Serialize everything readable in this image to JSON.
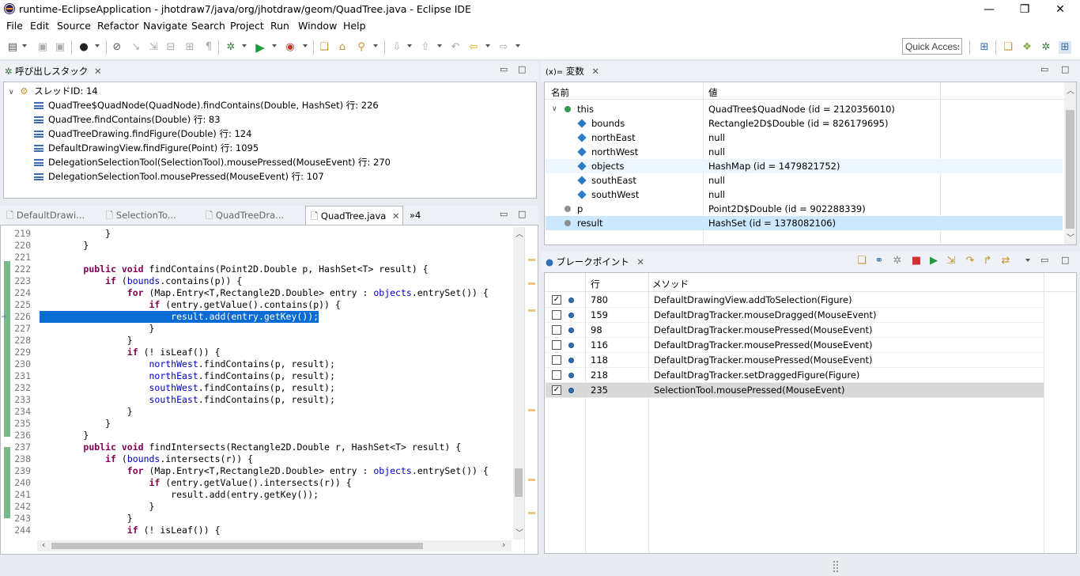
{
  "window": {
    "title": "runtime-EclipseApplication - jhotdraw7/java/org/jhotdraw/geom/QuadTree.java - Eclipse IDE",
    "minimize": "—",
    "restore": "❐",
    "close": "✕"
  },
  "menu": [
    "File",
    "Edit",
    "Source",
    "Refactor",
    "Navigate",
    "Search",
    "Project",
    "Run",
    "Window",
    "Help"
  ],
  "quick_access": "Quick Access",
  "callstack": {
    "tab_label": "呼び出しスタック",
    "thread": "スレッドID: 14",
    "frames": [
      "QuadTree$QuadNode(QuadNode).findContains(Double, HashSet) 行: 226",
      "QuadTree.findContains(Double) 行: 83",
      "QuadTreeDrawing.findFigure(Double) 行: 124",
      "DefaultDrawingView.findFigure(Point) 行: 1095",
      "DelegationSelectionTool(SelectionTool).mousePressed(MouseEvent) 行: 270",
      "DelegationSelectionTool.mousePressed(MouseEvent) 行: 107"
    ]
  },
  "editor": {
    "tabs": [
      "DefaultDrawi...",
      "SelectionTo...",
      "QuadTreeDra...",
      "QuadTree.java"
    ],
    "active_tab": 3,
    "overflow": "»4",
    "highlight_line": 226,
    "lines": [
      {
        "n": "219",
        "t": "            }"
      },
      {
        "n": "220",
        "t": "        }"
      },
      {
        "n": "221",
        "t": ""
      },
      {
        "n": "222",
        "t": "        public void findContains(Point2D.Double p, HashSet<T> result) {"
      },
      {
        "n": "223",
        "t": "            if (bounds.contains(p)) {"
      },
      {
        "n": "224",
        "t": "                for (Map.Entry<T,Rectangle2D.Double> entry : objects.entrySet()) {"
      },
      {
        "n": "225",
        "t": "                    if (entry.getValue().contains(p)) {"
      },
      {
        "n": "226",
        "t": "                        result.add(entry.getKey());"
      },
      {
        "n": "227",
        "t": "                    }"
      },
      {
        "n": "228",
        "t": "                }"
      },
      {
        "n": "229",
        "t": "                if (! isLeaf()) {"
      },
      {
        "n": "230",
        "t": "                    northWest.findContains(p, result);"
      },
      {
        "n": "231",
        "t": "                    northEast.findContains(p, result);"
      },
      {
        "n": "232",
        "t": "                    southWest.findContains(p, result);"
      },
      {
        "n": "233",
        "t": "                    southEast.findContains(p, result);"
      },
      {
        "n": "234",
        "t": "                }"
      },
      {
        "n": "235",
        "t": "            }"
      },
      {
        "n": "236",
        "t": "        }"
      },
      {
        "n": "237",
        "t": "        public void findIntersects(Rectangle2D.Double r, HashSet<T> result) {"
      },
      {
        "n": "238",
        "t": "            if (bounds.intersects(r)) {"
      },
      {
        "n": "239",
        "t": "                for (Map.Entry<T,Rectangle2D.Double> entry : objects.entrySet()) {"
      },
      {
        "n": "240",
        "t": "                    if (entry.getValue().intersects(r)) {"
      },
      {
        "n": "241",
        "t": "                        result.add(entry.getKey());"
      },
      {
        "n": "242",
        "t": "                    }"
      },
      {
        "n": "243",
        "t": "                }"
      },
      {
        "n": "244",
        "t": "                if (! isLeaf()) {"
      }
    ]
  },
  "variables": {
    "tab_label": "変数",
    "tab_prefix": "(x)=",
    "col_name": "名前",
    "col_value": "値",
    "rows": [
      {
        "name": "this",
        "value": "QuadTree$QuadNode (id = 2120356010)",
        "level": 0,
        "icon": "green-circle"
      },
      {
        "name": "bounds",
        "value": "Rectangle2D$Double (id = 826179695)",
        "level": 1,
        "icon": "diamond"
      },
      {
        "name": "northEast",
        "value": "null",
        "level": 1,
        "icon": "diamond"
      },
      {
        "name": "northWest",
        "value": "null",
        "level": 1,
        "icon": "diamond"
      },
      {
        "name": "objects",
        "value": "HashMap (id = 1479821752)",
        "level": 1,
        "icon": "diamond"
      },
      {
        "name": "southEast",
        "value": "null",
        "level": 1,
        "icon": "diamond"
      },
      {
        "name": "southWest",
        "value": "null",
        "level": 1,
        "icon": "diamond"
      },
      {
        "name": "p",
        "value": "Point2D$Double (id = 902288339)",
        "level": 0,
        "icon": "gray-circle"
      },
      {
        "name": "result",
        "value": "HashSet (id = 1378082106)",
        "level": 0,
        "icon": "gray-circle"
      }
    ],
    "selected_row": 8
  },
  "breakpoints": {
    "tab_label": "ブレークポイント",
    "col_line": "行",
    "col_method": "メソッド",
    "rows": [
      {
        "checked": true,
        "line": "780",
        "method": "DefaultDrawingView.addToSelection(Figure)"
      },
      {
        "checked": false,
        "line": "159",
        "method": "DefaultDragTracker.mouseDragged(MouseEvent)"
      },
      {
        "checked": false,
        "line": "98",
        "method": "DefaultDragTracker.mousePressed(MouseEvent)"
      },
      {
        "checked": false,
        "line": "116",
        "method": "DefaultDragTracker.mousePressed(MouseEvent)"
      },
      {
        "checked": false,
        "line": "118",
        "method": "DefaultDragTracker.mousePressed(MouseEvent)"
      },
      {
        "checked": false,
        "line": "218",
        "method": "DefaultDragTracker.setDraggedFigure(Figure)"
      },
      {
        "checked": true,
        "line": "235",
        "method": "SelectionTool.mousePressed(MouseEvent)"
      }
    ],
    "selected_row": 6
  },
  "colors": {
    "accent": "#0a6bd3",
    "keyword": "#7f0055",
    "field": "#0000c0",
    "selection": "#cce8ff"
  }
}
